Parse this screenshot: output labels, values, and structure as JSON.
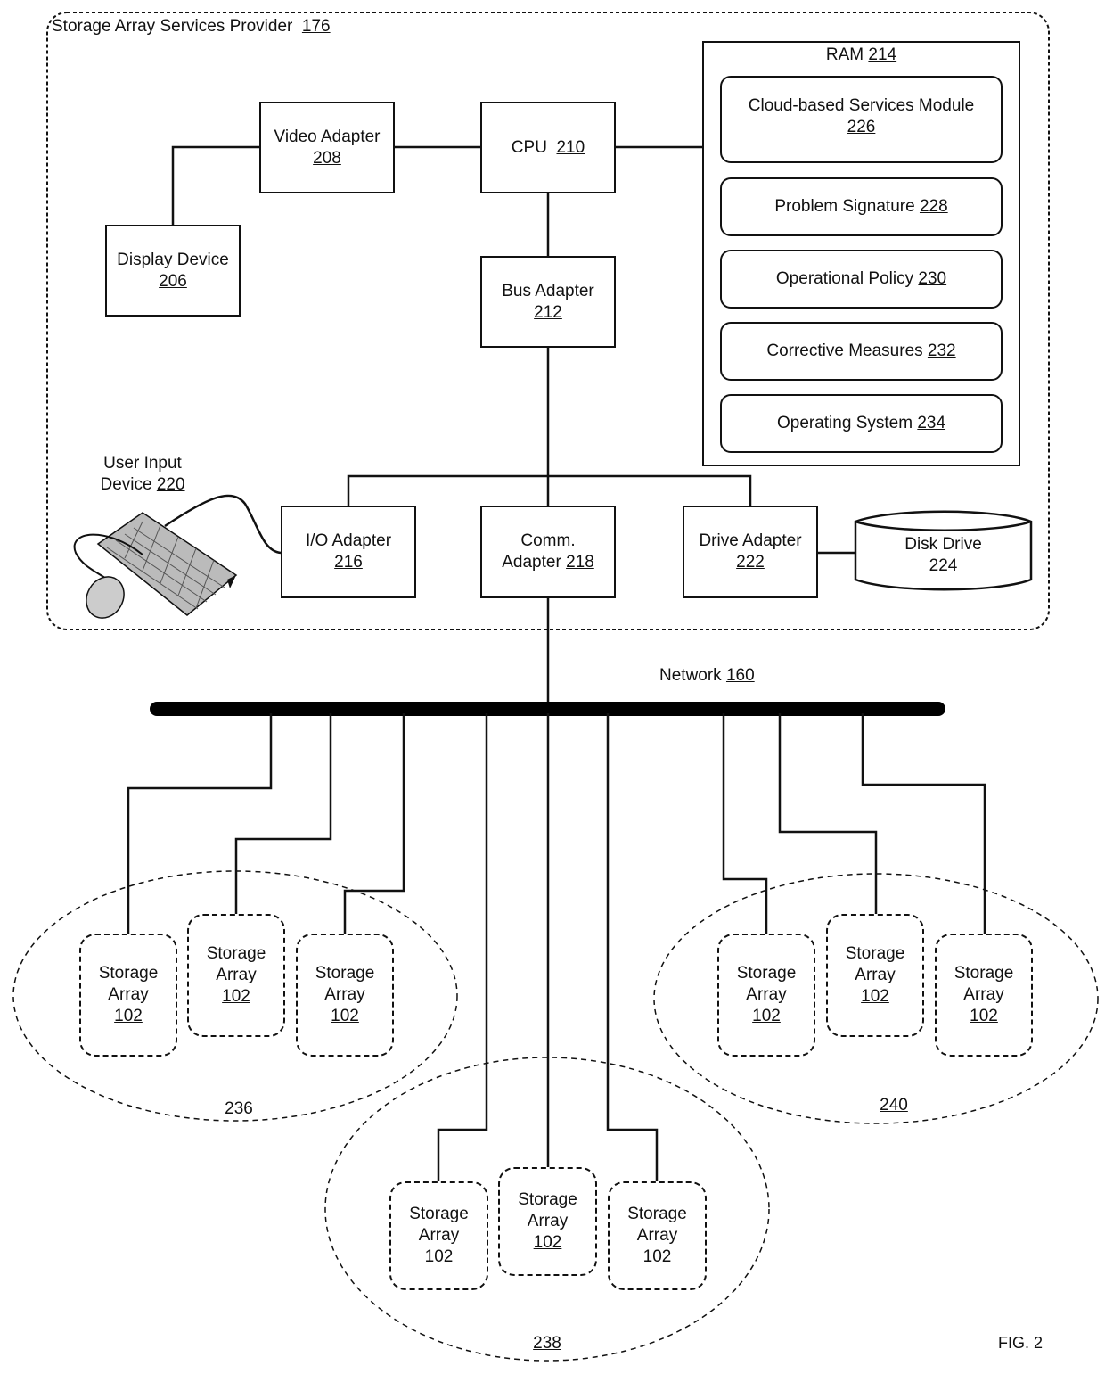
{
  "provider": {
    "label": "Storage Array Services Provider",
    "ref": "176"
  },
  "components": {
    "video_adapter": {
      "label": "Video Adapter",
      "ref": "208"
    },
    "cpu": {
      "label": "CPU",
      "ref": "210"
    },
    "display_device": {
      "label": "Display Device",
      "ref": "206"
    },
    "bus_adapter": {
      "label": "Bus Adapter",
      "ref": "212"
    },
    "user_input_device": {
      "label_line1": "User Input",
      "label_line2": "Device",
      "ref": "220"
    },
    "io_adapter": {
      "label": "I/O Adapter",
      "ref": "216"
    },
    "comm_adapter": {
      "label_line1": "Comm.",
      "label_line2": "Adapter",
      "ref": "218"
    },
    "drive_adapter": {
      "label": "Drive Adapter",
      "ref": "222"
    },
    "disk_drive": {
      "label": "Disk Drive",
      "ref": "224"
    }
  },
  "ram": {
    "label": "RAM",
    "ref": "214",
    "modules": [
      {
        "label": "Cloud-based Services Module",
        "ref": "226"
      },
      {
        "label": "Problem Signature",
        "ref": "228"
      },
      {
        "label": "Operational Policy",
        "ref": "230"
      },
      {
        "label": "Corrective Measures",
        "ref": "232"
      },
      {
        "label": "Operating System",
        "ref": "234"
      }
    ]
  },
  "network": {
    "label": "Network",
    "ref": "160"
  },
  "storage_array": {
    "line1": "Storage",
    "line2": "Array",
    "ref": "102"
  },
  "groups": [
    {
      "ref": "236"
    },
    {
      "ref": "238"
    },
    {
      "ref": "240"
    }
  ],
  "figure_label": "FIG. 2"
}
